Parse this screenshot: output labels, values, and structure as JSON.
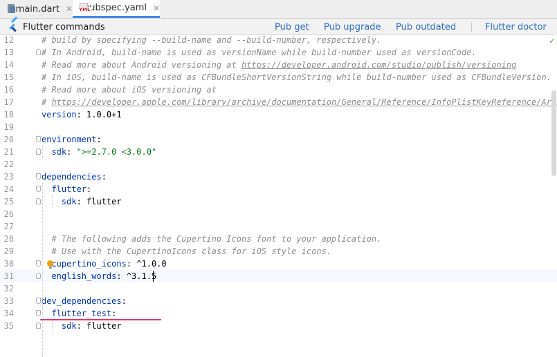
{
  "tabs": [
    {
      "label": "main.dart",
      "icon": "dart-file-icon",
      "active": false
    },
    {
      "label": "pubspec.yaml",
      "icon": "yaml-file-icon",
      "icon_text": "YML",
      "active": true
    }
  ],
  "commands_bar": {
    "title": "Flutter commands",
    "buttons": [
      "Pub get",
      "Pub upgrade",
      "Pub outdated",
      "Flutter doctor"
    ]
  },
  "editor": {
    "current_line": 31,
    "lines": [
      {
        "n": "12",
        "text": "# build by specifying --build-name and --build-number, respectively."
      },
      {
        "n": "13",
        "text": "# In Android, build-name is used as versionName while build-number used as versionCode."
      },
      {
        "n": "14",
        "prefix": "# Read more about Android versioning at ",
        "url": "https://developer.android.com/studio/publish/versioning"
      },
      {
        "n": "15",
        "text": "# In iOS, build-name is used as CFBundleShortVersionString while build-number used as CFBundleVersion."
      },
      {
        "n": "16",
        "text": "# Read more about iOS versioning at"
      },
      {
        "n": "17",
        "prefix": "# ",
        "url": "https://developer.apple.com/library/archive/documentation/General/Reference/InfoPlistKeyReference/Articles"
      },
      {
        "n": "18",
        "key": "version",
        "value": " 1.0.0+1"
      },
      {
        "n": "19"
      },
      {
        "n": "20",
        "key": "environment"
      },
      {
        "n": "21",
        "key": "  sdk",
        "str": " \">=2.7.0 <3.0.0\""
      },
      {
        "n": "22"
      },
      {
        "n": "23",
        "key": "dependencies"
      },
      {
        "n": "24",
        "key": "  flutter"
      },
      {
        "n": "25",
        "key": "    sdk",
        "value": " flutter"
      },
      {
        "n": "26"
      },
      {
        "n": "27"
      },
      {
        "n": "28",
        "text": "  # The following adds the Cupertino Icons font to your application."
      },
      {
        "n": "29",
        "text": "  # Use with the CupertinoIcons class for iOS style icons."
      },
      {
        "n": "30",
        "key": "  cupertino_icons",
        "value": " ^1.0.0"
      },
      {
        "n": "31",
        "key": "  english_words",
        "value": " ^3.1.5"
      },
      {
        "n": "32"
      },
      {
        "n": "33",
        "key": "dev_dependencies"
      },
      {
        "n": "34",
        "key": "  flutter_test"
      },
      {
        "n": "35",
        "key": "    sdk",
        "value": " flutter"
      }
    ]
  },
  "colors": {
    "tab_active_underline": "#3f8be6",
    "command_link": "#2f6fc8",
    "key": "#0033b3",
    "string": "#067d17",
    "comment": "#8c8c8c",
    "annotation_underline": "#e8336a",
    "intention_bulb": "#f0a30a"
  }
}
